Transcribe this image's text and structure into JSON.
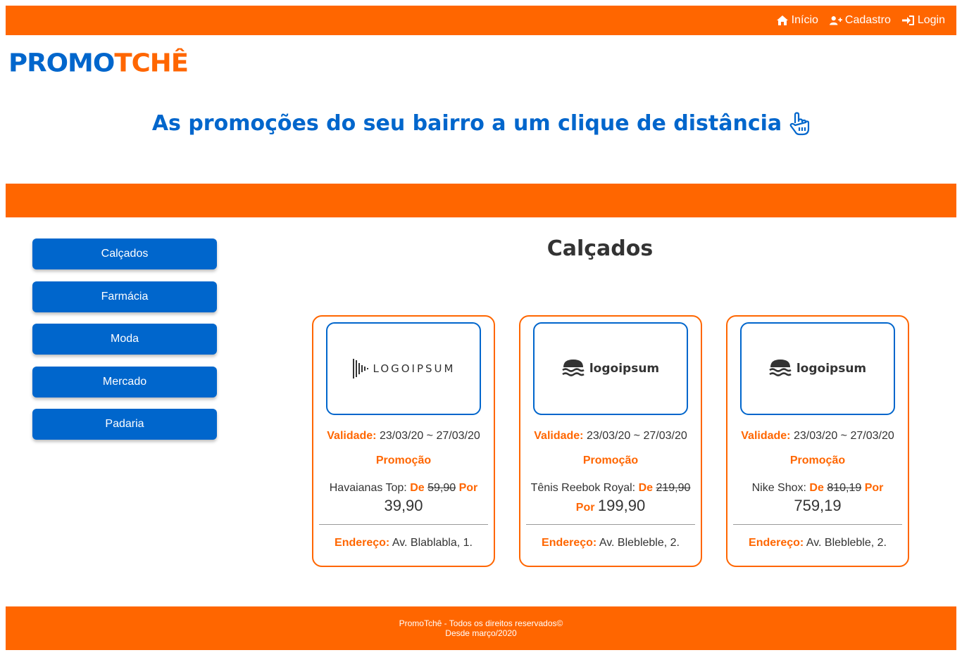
{
  "nav": {
    "home": "Início",
    "register": "Cadastro",
    "login": "Login"
  },
  "brand": {
    "part1": "PROMO",
    "part2": "TCHÊ"
  },
  "headline": "As promoções do seu bairro a um clique de distância",
  "categories": [
    "Calçados",
    "Farmácia",
    "Moda",
    "Mercado",
    "Padaria"
  ],
  "section_title": "Calçados",
  "labels": {
    "validity": "Validade:",
    "promo": "Promoção",
    "from": "De",
    "to": "Por",
    "address": "Endereço:"
  },
  "cards": [
    {
      "logo_text": "LOGOIPSUM",
      "logo_style": "bars",
      "validity": "23/03/20 ~ 27/03/20",
      "product": "Havaianas Top:",
      "old_price": "59,90",
      "new_price": "39,90",
      "address": "Av. Blablabla, 1."
    },
    {
      "logo_text": "logoipsum",
      "logo_style": "waves",
      "validity": "23/03/20 ~ 27/03/20",
      "product": "Tênis Reebok Royal:",
      "old_price": "219,90",
      "new_price": "199,90",
      "address": "Av. Blebleble, 2."
    },
    {
      "logo_text": "logoipsum",
      "logo_style": "waves",
      "validity": "23/03/20 ~ 27/03/20",
      "product": "Nike Shox:",
      "old_price": "810,19",
      "new_price": "759,19",
      "address": "Av. Blebleble, 2."
    }
  ],
  "footer": {
    "line1": "PromoTchê - Todos os direitos reservados©",
    "line2": "Desde março/2020"
  },
  "colors": {
    "orange": "#ff6600",
    "blue": "#0066cc"
  }
}
